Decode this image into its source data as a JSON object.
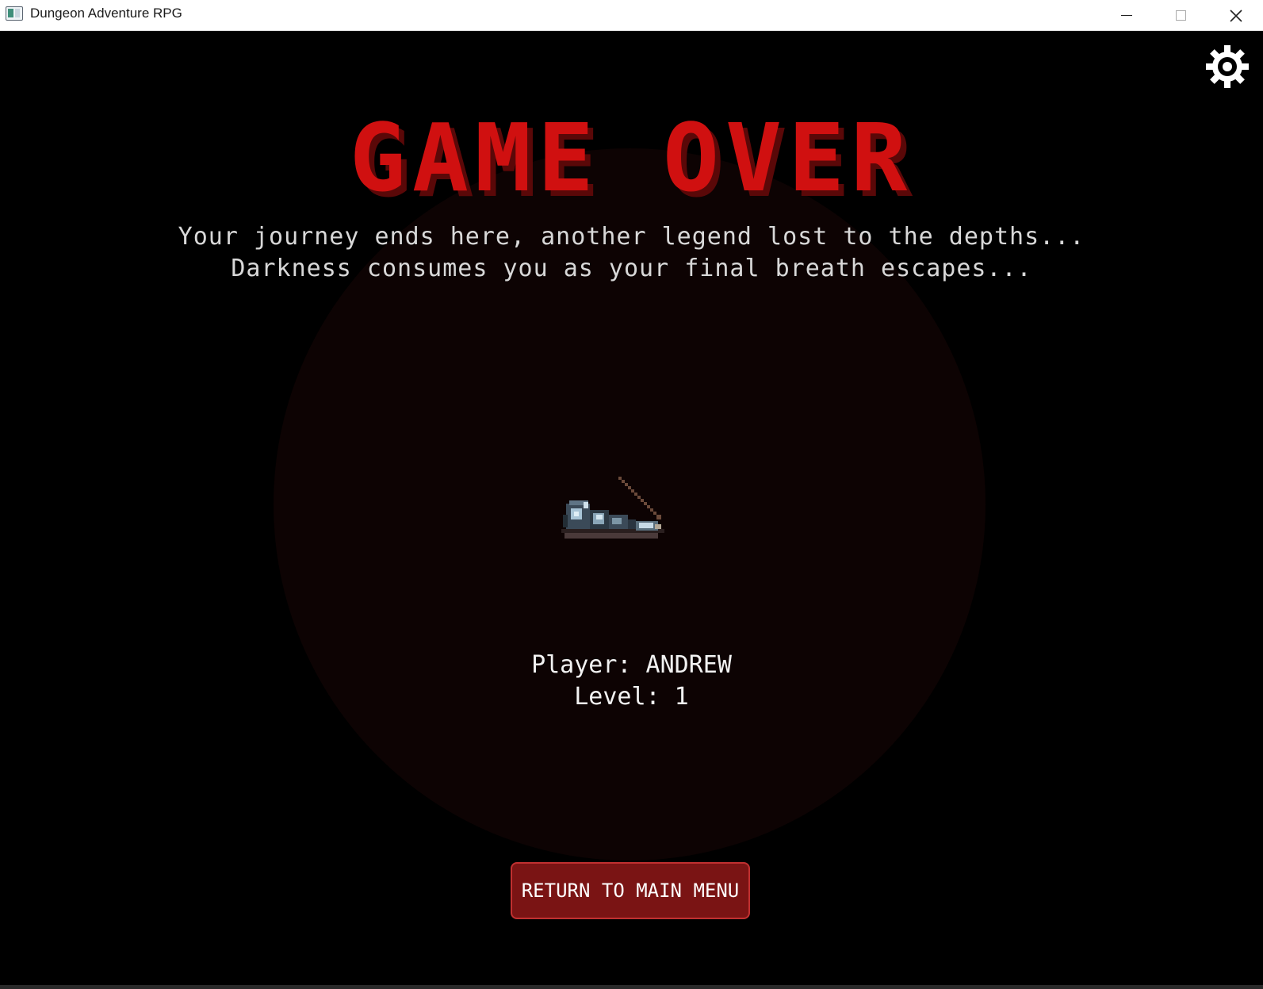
{
  "window": {
    "title": "Dungeon Adventure RPG"
  },
  "screen": {
    "heading": "GAME OVER",
    "message_line1": "Your journey ends here, another legend lost to the depths...",
    "message_line2": "Darkness consumes you as your final breath escapes...",
    "player_label": "Player: ANDREW",
    "level_label": "Level: 1",
    "return_button": "RETURN TO MAIN MENU"
  },
  "icons": {
    "settings": "gear-icon",
    "player_sprite": "fallen-knight-sprite"
  },
  "colors": {
    "background": "#000000",
    "heading": "#d01010",
    "heading_shadow": "#5a0808",
    "glow": "#0d0303",
    "button": "#7a1414",
    "text": "#f2f2f2"
  }
}
